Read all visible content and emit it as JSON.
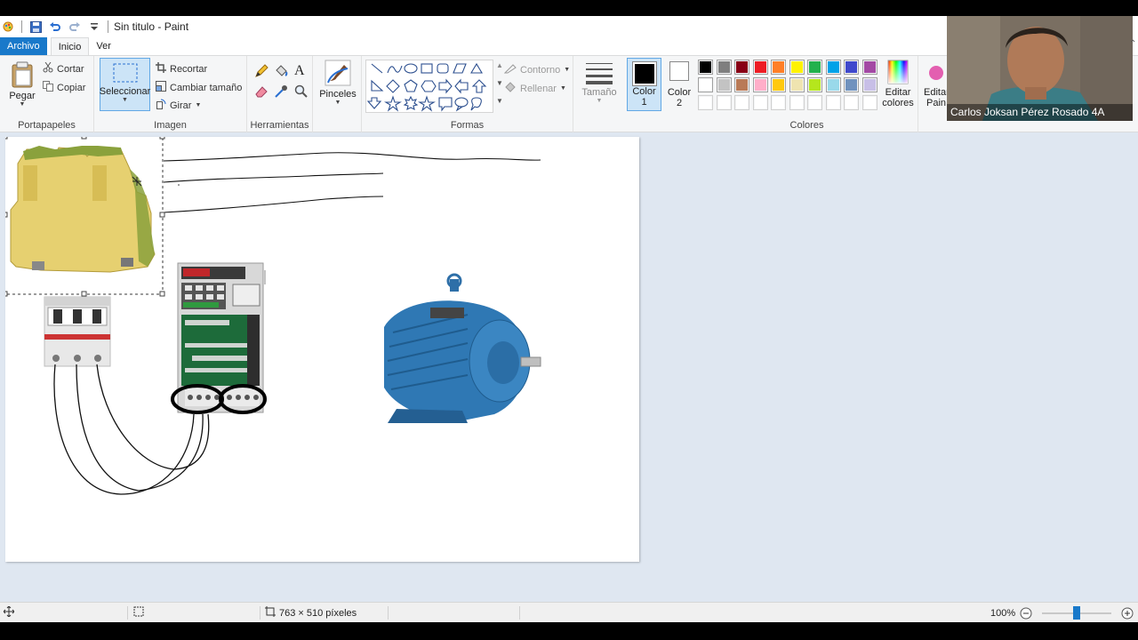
{
  "window": {
    "title": "Sin titulo - Paint"
  },
  "tabs": {
    "file": "Archivo",
    "home": "Inicio",
    "view": "Ver"
  },
  "ribbon": {
    "clipboard": {
      "label": "Portapapeles",
      "paste": "Pegar",
      "cut": "Cortar",
      "copy": "Copiar"
    },
    "image": {
      "label": "Imagen",
      "select": "Seleccionar",
      "crop": "Recortar",
      "resize": "Cambiar tamaño",
      "rotate": "Girar"
    },
    "tools": {
      "label": "Herramientas"
    },
    "brushes": {
      "label": "Pinceles"
    },
    "shapes": {
      "label": "Formas",
      "outline": "Contorno",
      "fill": "Rellenar"
    },
    "size": {
      "label": "Tamaño"
    },
    "color1": {
      "label": "Color",
      "num": "1",
      "value": "#000000"
    },
    "color2": {
      "label": "Color",
      "num": "2",
      "value": "#ffffff"
    },
    "colors": {
      "label": "Colores",
      "palette_row1": [
        "#000000",
        "#7f7f7f",
        "#880015",
        "#ed1c24",
        "#ff7f27",
        "#fff200",
        "#22b14c",
        "#00a2e8",
        "#3f48cc",
        "#a349a4"
      ],
      "palette_row2": [
        "#ffffff",
        "#c3c3c3",
        "#b97a57",
        "#ffaec9",
        "#ffc90e",
        "#efe4b0",
        "#b5e61d",
        "#99d9ea",
        "#7092be",
        "#c8bfe7"
      ],
      "palette_row3": [
        "#ffffff",
        "#ffffff",
        "#ffffff",
        "#ffffff",
        "#ffffff",
        "#ffffff",
        "#ffffff",
        "#ffffff",
        "#ffffff",
        "#ffffff"
      ],
      "edit": "Editar colores"
    },
    "paint3d": {
      "label": "Editar Pain"
    }
  },
  "statusbar": {
    "size": "763 × 510 píxeles",
    "zoom": "100%"
  },
  "webcam": {
    "name": "Carlos Joksan Pérez Rosado 4A"
  },
  "canvas": {
    "items": [
      "terminal-block",
      "circuit-breaker",
      "frequency-drive",
      "electric-motor"
    ]
  }
}
